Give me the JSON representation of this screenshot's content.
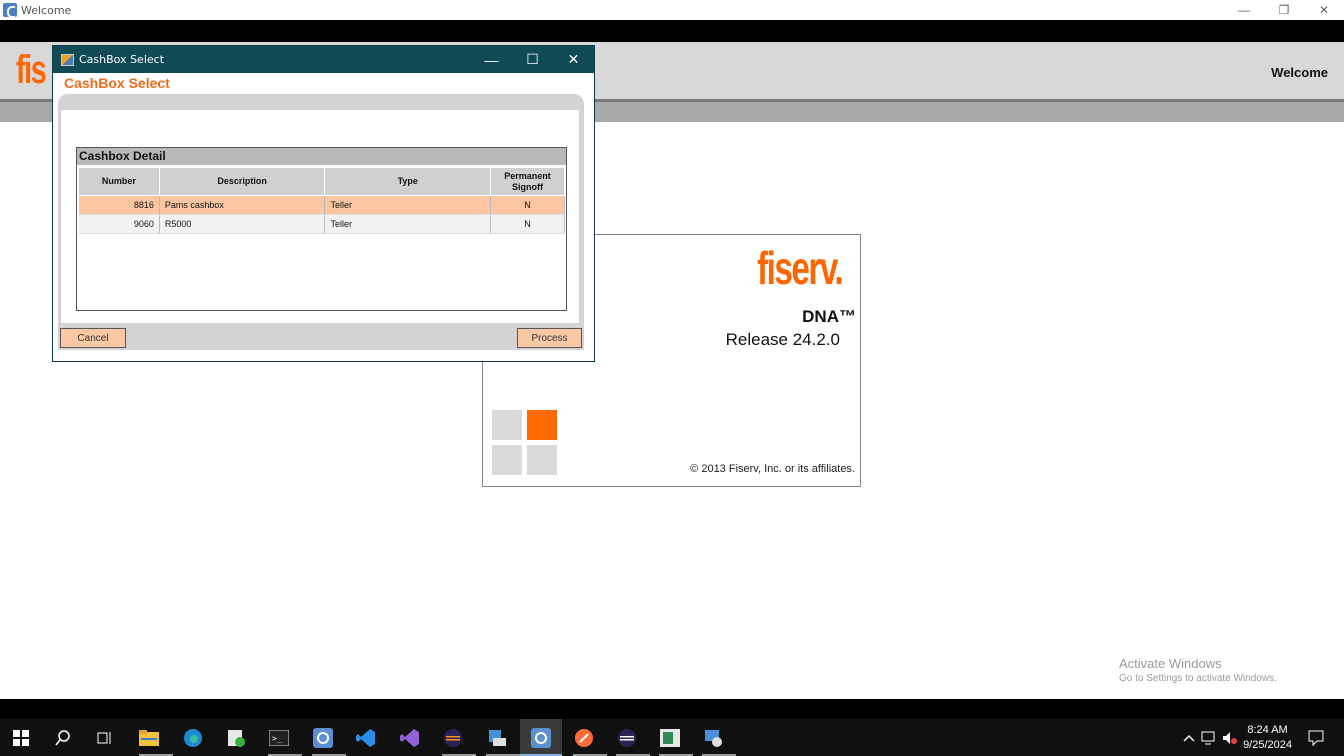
{
  "window": {
    "title": "Welcome",
    "controls": [
      "—",
      "❐",
      "✕"
    ]
  },
  "header": {
    "logo_text": "fis",
    "welcome": "Welcome"
  },
  "splash": {
    "brand": "fiserv.",
    "product": "DNA™",
    "release": "Release 24.2.0",
    "copyright": "© 2013 Fiserv, Inc. or its affiliates."
  },
  "dialog": {
    "title": "CashBox Select",
    "heading": "CashBox Select",
    "controls": [
      "—",
      "☐",
      "✕"
    ],
    "detail_title": "Cashbox Detail",
    "columns": {
      "number": "Number",
      "description": "Description",
      "type": "Type",
      "permanent_line1": "Permanent",
      "permanent_line2": "Signoff"
    },
    "rows": [
      {
        "number": "8816",
        "description": "Pams cashbox",
        "type": "Teller",
        "signoff": "N"
      },
      {
        "number": "9060",
        "description": "R5000",
        "type": "Teller",
        "signoff": "N"
      }
    ],
    "cancel_label": "Cancel",
    "process_label": "Process"
  },
  "watermark": {
    "title": "Activate Windows",
    "subtitle": "Go to Settings to activate Windows."
  },
  "taskbar": {
    "time": "8:24 AM",
    "date": "9/25/2024"
  },
  "colors": {
    "accent_orange": "#ff6600",
    "dialog_title": "#0f4a55",
    "selected_row": "#fcc6a2",
    "button": "#fbc8a6"
  }
}
